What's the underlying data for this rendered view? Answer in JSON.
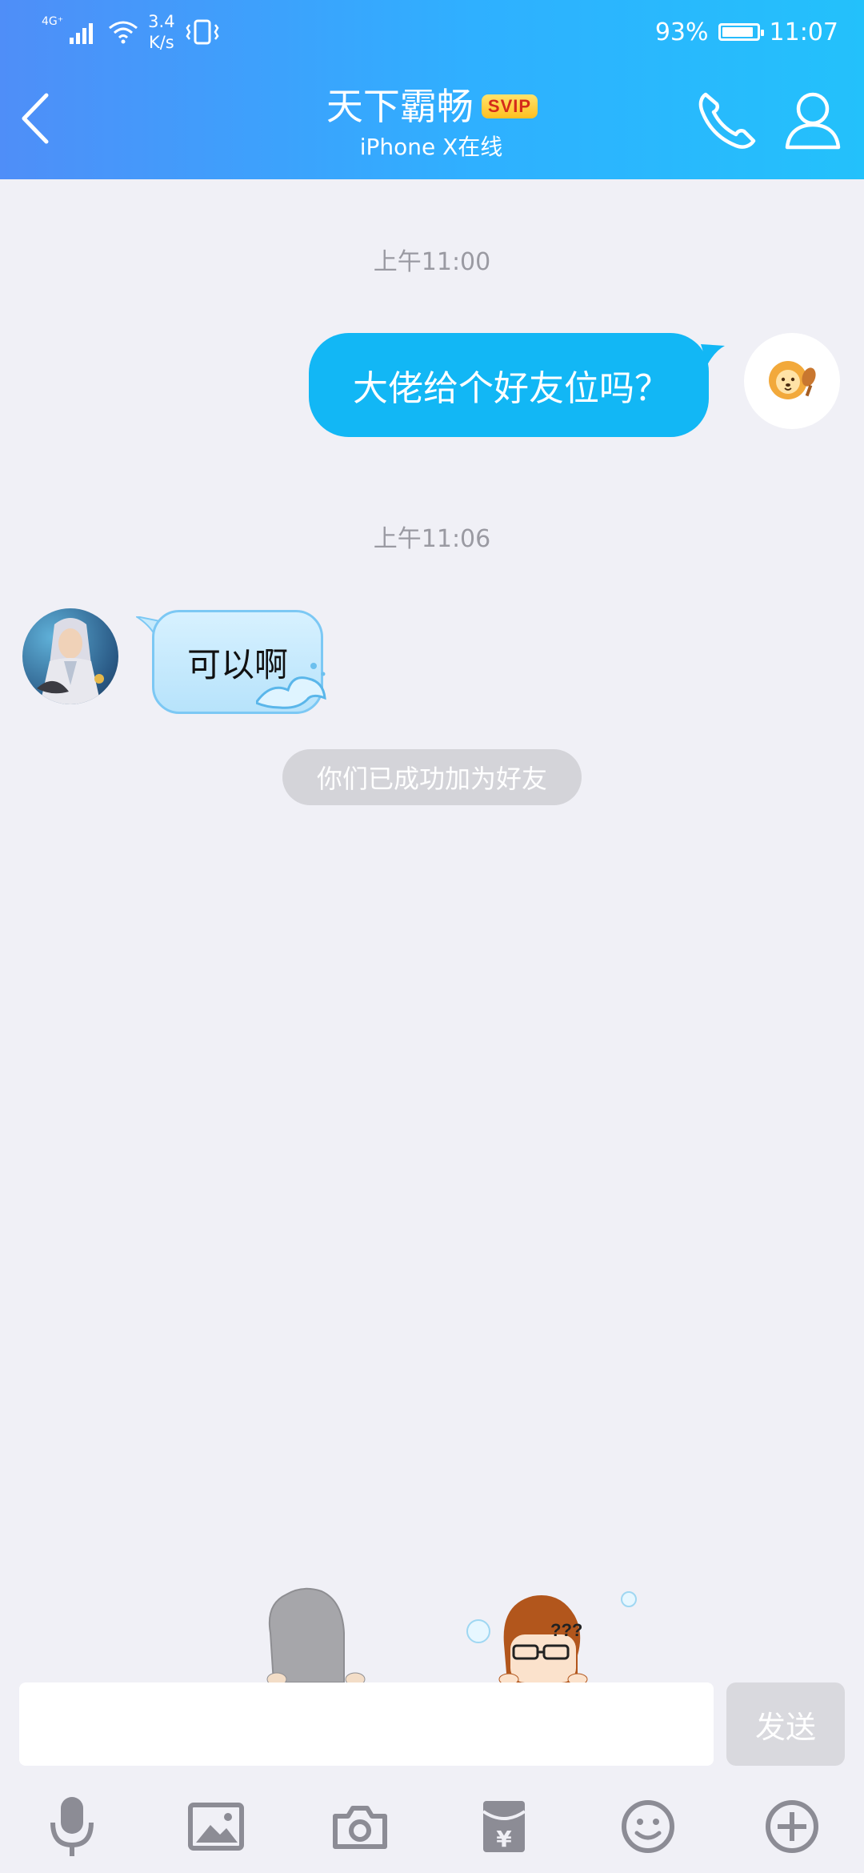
{
  "status_bar": {
    "network": "4G⁺",
    "speed_value": "3.4",
    "speed_unit": "K/s",
    "battery": "93%",
    "battery_level": 0.93,
    "time": "11:07"
  },
  "header": {
    "title": "天下霸畅",
    "badge": "SVIP",
    "subtitle": "iPhone X在线",
    "icons": [
      "back-chevron-icon",
      "phone-icon",
      "profile-icon"
    ]
  },
  "messages": {
    "timestamp_1": "上午11:00",
    "outgoing_text": "大佬给个好友位吗？",
    "timestamp_2": "上午11:06",
    "incoming_text": "可以啊",
    "system_note": "你们已成功加为好友"
  },
  "composer": {
    "input_value": "",
    "send_label": "发送"
  },
  "toolbar": {
    "icons": [
      "microphone-icon",
      "image-icon",
      "camera-icon",
      "red-packet-icon",
      "emoji-icon",
      "plus-icon"
    ]
  },
  "colors": {
    "header_gradient_start": "#4f8ef8",
    "header_gradient_end": "#23c1fb",
    "outgoing_bubble": "#12b7f5",
    "svip_badge": "#ffc93a",
    "chat_background": "#f0f0f6"
  }
}
